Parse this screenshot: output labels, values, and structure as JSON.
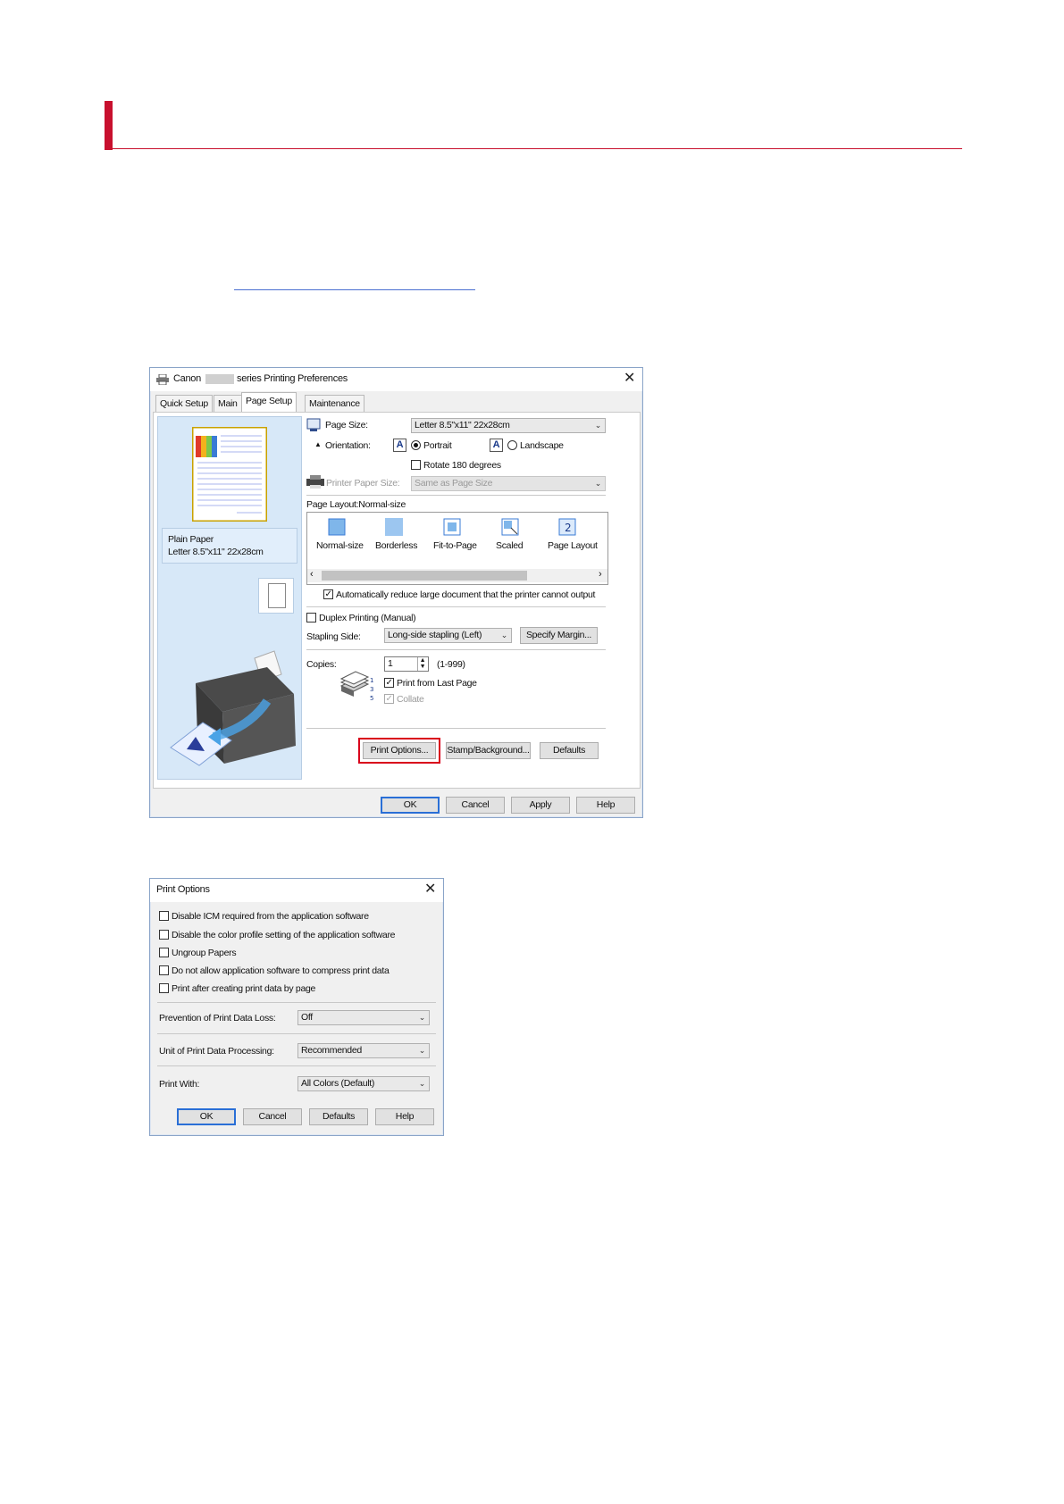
{
  "dialog1": {
    "title_prefix": "Canon",
    "title_suffix": "series Printing Preferences",
    "tabs": [
      "Quick Setup",
      "Main",
      "Page Setup",
      "Maintenance"
    ],
    "active_tab": "Page Setup",
    "preview": {
      "media_type": "Plain Paper",
      "media_size": "Letter 8.5\"x11\" 22x28cm"
    },
    "page_size": {
      "label": "Page Size:",
      "value": "Letter 8.5\"x11\" 22x28cm"
    },
    "orientation": {
      "label": "Orientation:",
      "portrait": "Portrait",
      "landscape": "Landscape",
      "selected": "Portrait"
    },
    "rotate_180": {
      "label": "Rotate 180 degrees",
      "checked": false
    },
    "printer_paper_size": {
      "label": "Printer Paper Size:",
      "value": "Same as Page Size"
    },
    "page_layout": {
      "label": "Page Layout:Normal-size",
      "items": [
        "Normal-size",
        "Borderless",
        "Fit-to-Page",
        "Scaled",
        "Page Layout"
      ]
    },
    "auto_reduce": {
      "label": "Automatically reduce large document that the printer cannot output",
      "checked": true
    },
    "duplex": {
      "label": "Duplex Printing (Manual)",
      "checked": false
    },
    "stapling": {
      "label": "Stapling Side:",
      "value": "Long-side stapling (Left)",
      "button": "Specify Margin..."
    },
    "copies": {
      "label": "Copies:",
      "value": "1",
      "range": "(1-999)"
    },
    "print_from_last": {
      "label": "Print from Last Page",
      "checked": true
    },
    "collate": {
      "label": "Collate",
      "checked": true
    },
    "buttons": {
      "print_options": "Print Options...",
      "stamp_background": "Stamp/Background...",
      "defaults": "Defaults",
      "ok": "OK",
      "cancel": "Cancel",
      "apply": "Apply",
      "help": "Help"
    },
    "highlight_color": "#d9001b"
  },
  "dialog2": {
    "title": "Print Options",
    "checkboxes": [
      "Disable ICM required from the application software",
      "Disable the color profile setting of the application software",
      "Ungroup Papers",
      "Do not allow application software to compress print data",
      "Print after creating print data by page"
    ],
    "prevention": {
      "label": "Prevention of Print Data Loss:",
      "value": "Off"
    },
    "unit": {
      "label": "Unit of Print Data Processing:",
      "value": "Recommended"
    },
    "print_with": {
      "label": "Print With:",
      "value": "All Colors (Default)"
    },
    "buttons": {
      "ok": "OK",
      "cancel": "Cancel",
      "defaults": "Defaults",
      "help": "Help"
    }
  },
  "colors": {
    "heading_accent": "#c8102e",
    "link": "#4a6fd1",
    "preview_bg": "#d7e8f8",
    "focus": "#2a6fd6"
  }
}
